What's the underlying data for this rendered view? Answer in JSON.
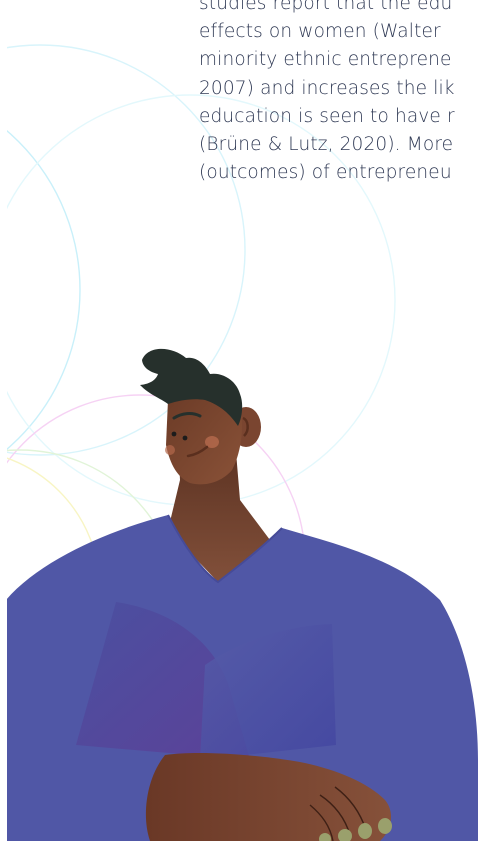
{
  "article": {
    "lines": [
      "studies report that the edu",
      "effects on women (Walter",
      "minority ethnic entreprene",
      "2007) and increases the lik",
      "education is seen to have r",
      "(Brüne & Lutz, 2020). More",
      "(outcomes) of entrepreneu"
    ]
  },
  "illustration": {
    "subject": "person-illustration",
    "colors": {
      "shirt": "#5057a6",
      "skin": "#7a4530",
      "hair": "#26302c",
      "text": "#303a55"
    }
  }
}
